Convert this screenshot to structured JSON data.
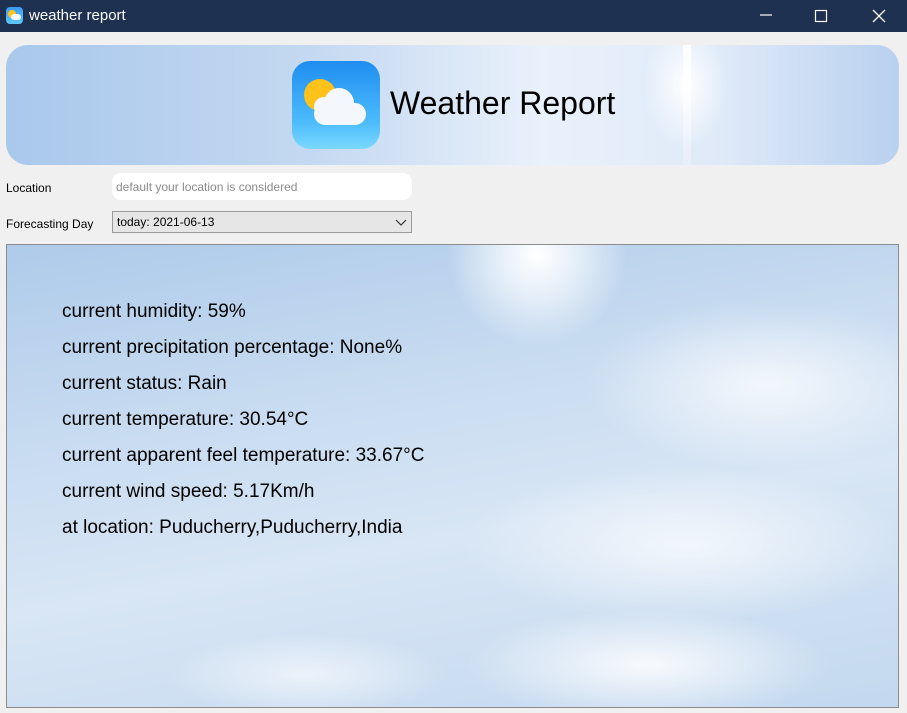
{
  "window": {
    "title": "weather report"
  },
  "banner": {
    "title": "Weather Report"
  },
  "form": {
    "location_label": "Location",
    "location_placeholder": "default your location is considered",
    "location_value": "",
    "forecast_label": "Forecasting Day",
    "forecast_selected": "today: 2021-06-13"
  },
  "report": {
    "lines": [
      "current humidity: 59%",
      "current precipitation percentage: None%",
      "current status: Rain",
      "current temperature: 30.54°C",
      "current apparent feel temperature: 33.67°C",
      "current wind speed: 5.17Km/h",
      "at location: Puducherry,Puducherry,India"
    ]
  },
  "icons": {
    "app": "weather-app-icon",
    "logo": "sun-cloud-icon",
    "minimize": "minimize-icon",
    "maximize": "maximize-icon",
    "close": "close-icon",
    "dropdown": "chevron-down-icon"
  },
  "colors": {
    "titlebar": "#1e3150",
    "accent": "#1e8df0",
    "sun": "#ffc21a"
  }
}
